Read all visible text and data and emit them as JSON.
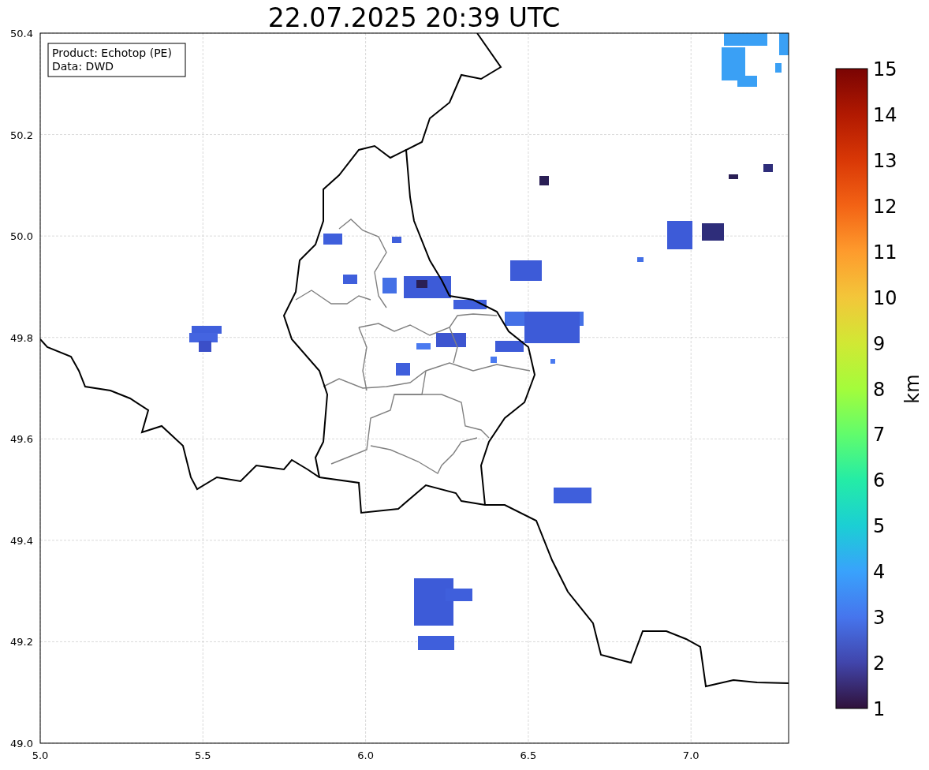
{
  "title": "22.07.2025 20:39 UTC",
  "info_box": {
    "lines": [
      "Product: Echotop (PE)",
      "Data: DWD"
    ]
  },
  "map": {
    "xticks": [
      "5.0",
      "5.5",
      "6.0",
      "6.5",
      "7.0"
    ],
    "yticks": [
      "50.4",
      "50.2",
      "50.0",
      "49.8",
      "49.6",
      "49.4",
      "49.2",
      "49.0"
    ]
  },
  "colorbar": {
    "label": "km",
    "ticks": [
      "15",
      "14",
      "13",
      "12",
      "11",
      "10",
      "9",
      "8",
      "7",
      "6",
      "5",
      "4",
      "3",
      "2",
      "1"
    ]
  }
}
